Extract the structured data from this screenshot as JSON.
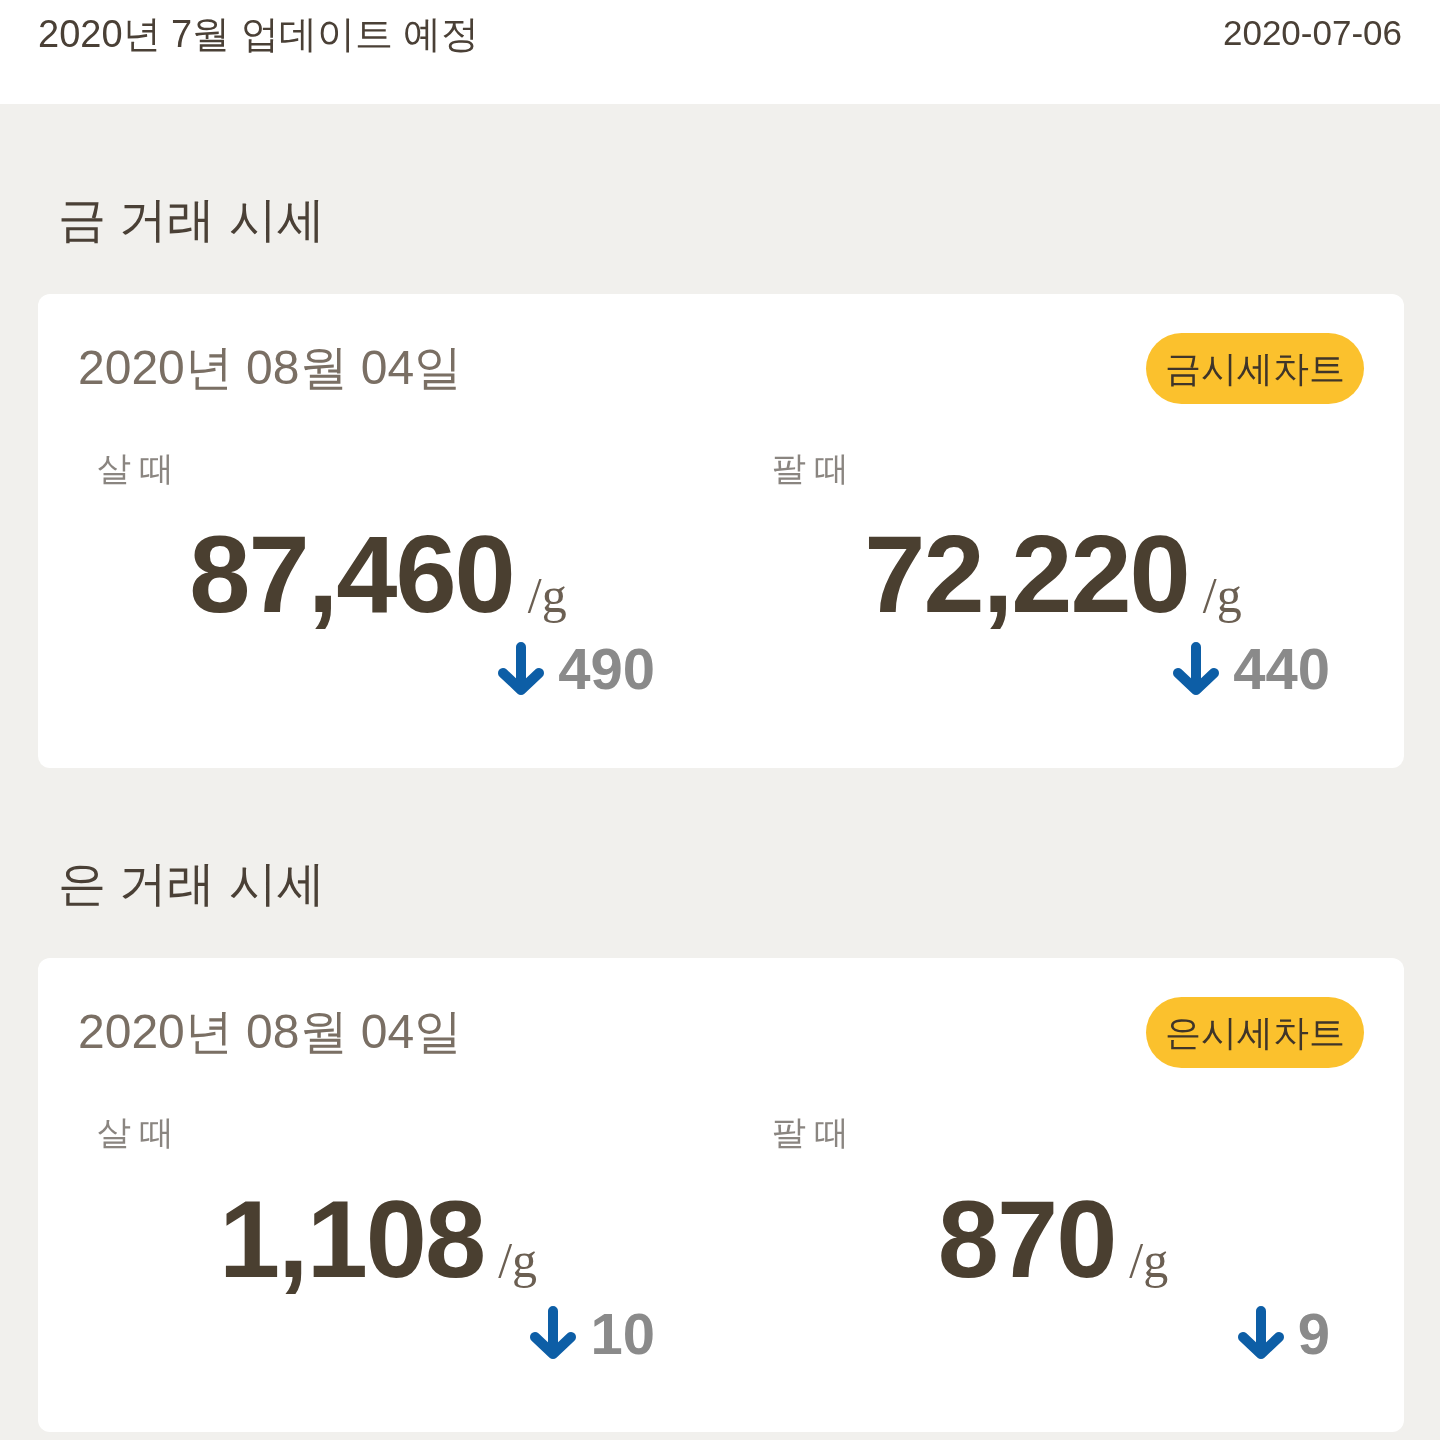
{
  "header": {
    "title": "2020년 7월 업데이트 예정",
    "date": "2020-07-06"
  },
  "sections": [
    {
      "title": "금 거래 시세",
      "card": {
        "date": "2020년 08월 04일",
        "chart_button": "금시세차트",
        "prices": [
          {
            "label": "살 때",
            "value": "87,460",
            "unit": "/g",
            "falling": true,
            "change": "490"
          },
          {
            "label": "팔 때",
            "value": "72,220",
            "unit": "/g",
            "falling": true,
            "change": "440"
          }
        ]
      }
    },
    {
      "title": "은 거래 시세",
      "card": {
        "date": "2020년 08월 04일",
        "chart_button": "은시세차트",
        "prices": [
          {
            "label": "살 때",
            "value": "1,108",
            "unit": "/g",
            "falling": true,
            "change": "10"
          },
          {
            "label": "팔 때",
            "value": "870",
            "unit": "/g",
            "falling": true,
            "change": "9"
          }
        ]
      }
    }
  ]
}
